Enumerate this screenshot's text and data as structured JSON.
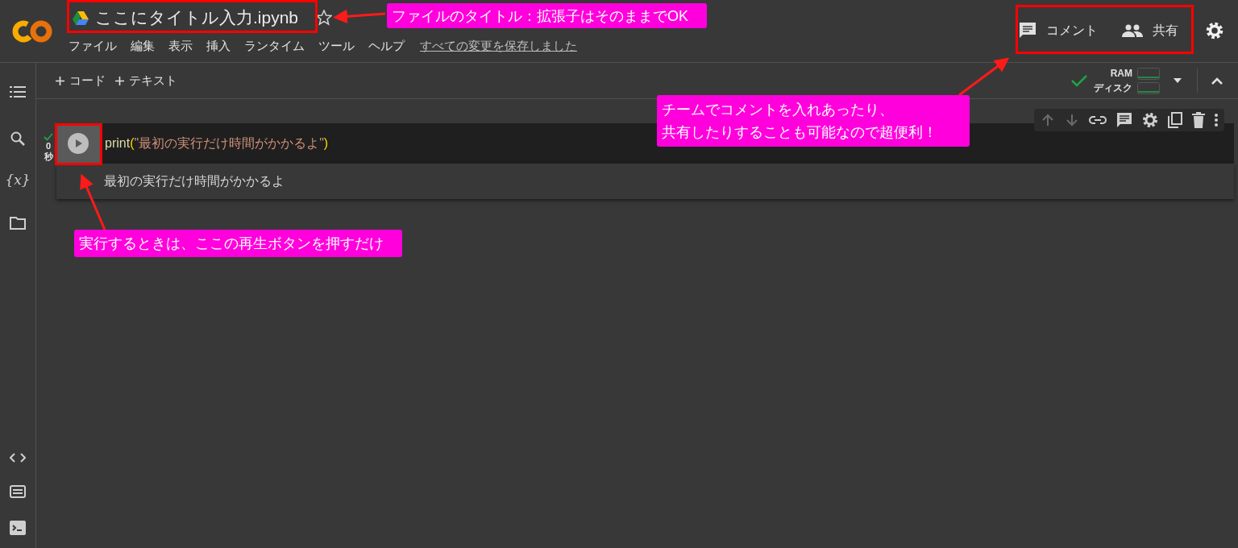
{
  "header": {
    "title": "ここにタイトル入力.ipynb",
    "starred": false,
    "menu": [
      "ファイル",
      "編集",
      "表示",
      "挿入",
      "ランタイム",
      "ツール",
      "ヘルプ"
    ],
    "save_status": "すべての変更を保存しました",
    "actions": [
      {
        "kind": "comment",
        "label": "コメント"
      },
      {
        "kind": "share",
        "label": "共有"
      }
    ]
  },
  "toolbar": {
    "add_buttons": [
      "コード",
      "テキスト"
    ],
    "connected": true,
    "resources": [
      "RAM",
      "ディスク"
    ]
  },
  "sidebar": {
    "variables_glyph": "{x}"
  },
  "cell": {
    "code": [
      {
        "kind": "function",
        "text": "print"
      },
      {
        "kind": "paren",
        "text": "("
      },
      {
        "kind": "string",
        "text": "\"最初の実行だけ時間がかかるよ\""
      },
      {
        "kind": "paren",
        "text": ")"
      }
    ],
    "run_ok": true,
    "exec_time": "0",
    "exec_unit": "秒",
    "output": "最初の実行だけ時間がかかるよ"
  },
  "annotations": [
    {
      "lines": [
        "ファイルのタイトル：拡張子はそのままでOK"
      ]
    },
    {
      "lines": [
        "チームでコメントを入れあったり、",
        "共有したりすることも可能なので超便利！"
      ]
    },
    {
      "lines": [
        "実行するときは、ここの再生ボタンを押すだけ"
      ]
    }
  ]
}
